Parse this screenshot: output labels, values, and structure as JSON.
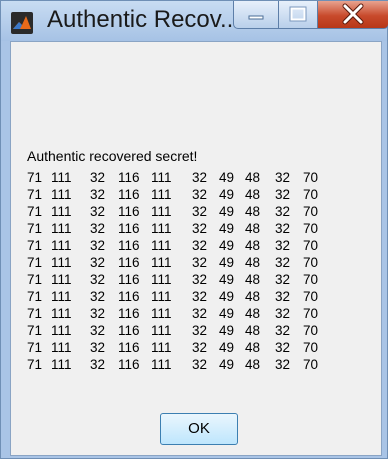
{
  "window": {
    "title": "Authentic Recov...",
    "icon": "matlab-icon",
    "controls": [
      "minimize-icon",
      "maximize-icon",
      "close-icon"
    ],
    "close_color": "#c84a2c"
  },
  "message": {
    "title": "Authentic recovered secret!",
    "rows": [
      [
        "71",
        "111",
        "32",
        "116",
        "111",
        "32",
        "49",
        "48",
        "32",
        "70"
      ],
      [
        "71",
        "111",
        "32",
        "116",
        "111",
        "32",
        "49",
        "48",
        "32",
        "70"
      ],
      [
        "71",
        "111",
        "32",
        "116",
        "111",
        "32",
        "49",
        "48",
        "32",
        "70"
      ],
      [
        "71",
        "111",
        "32",
        "116",
        "111",
        "32",
        "49",
        "48",
        "32",
        "70"
      ],
      [
        "71",
        "111",
        "32",
        "116",
        "111",
        "32",
        "49",
        "48",
        "32",
        "70"
      ],
      [
        "71",
        "111",
        "32",
        "116",
        "111",
        "32",
        "49",
        "48",
        "32",
        "70"
      ],
      [
        "71",
        "111",
        "32",
        "116",
        "111",
        "32",
        "49",
        "48",
        "32",
        "70"
      ],
      [
        "71",
        "111",
        "32",
        "116",
        "111",
        "32",
        "49",
        "48",
        "32",
        "70"
      ],
      [
        "71",
        "111",
        "32",
        "116",
        "111",
        "32",
        "49",
        "48",
        "32",
        "70"
      ],
      [
        "71",
        "111",
        "32",
        "116",
        "111",
        "32",
        "49",
        "48",
        "32",
        "70"
      ],
      [
        "71",
        "111",
        "32",
        "116",
        "111",
        "32",
        "49",
        "48",
        "32",
        "70"
      ],
      [
        "71",
        "111",
        "32",
        "116",
        "111",
        "32",
        "49",
        "48",
        "32",
        "70"
      ]
    ]
  },
  "buttons": {
    "ok_label": "OK"
  }
}
